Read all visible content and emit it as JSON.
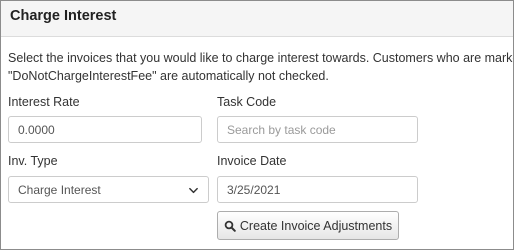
{
  "panel": {
    "title": "Charge Interest",
    "intro_line1": "Select the invoices that you would like to charge interest towards. Customers who are marked as",
    "intro_line2": "\"DoNotChargeInterestFee\" are automatically not checked."
  },
  "form": {
    "interest_rate": {
      "label": "Interest Rate",
      "value": "0.0000"
    },
    "task_code": {
      "label": "Task Code",
      "value": "",
      "placeholder": "Search by task code"
    },
    "inv_type": {
      "label": "Inv. Type",
      "selected": "Charge Interest",
      "icon": "chevron-down-icon"
    },
    "invoice_date": {
      "label": "Invoice Date",
      "value": "3/25/2021"
    }
  },
  "actions": {
    "create_label": "Create Invoice Adjustments",
    "create_icon": "search-icon"
  }
}
